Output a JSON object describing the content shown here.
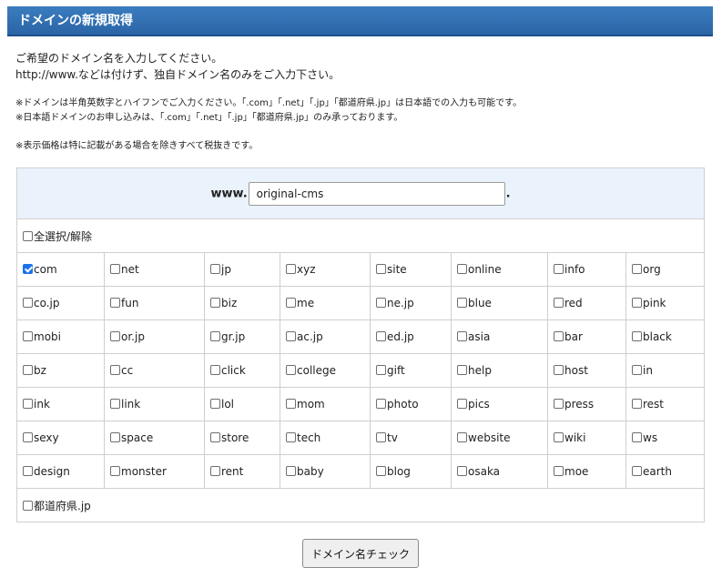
{
  "header": {
    "title": "ドメインの新規取得"
  },
  "intro": {
    "line1": "ご希望のドメイン名を入力してください。",
    "line2": "http://www.などは付けず、独自ドメイン名のみをご入力下さい。"
  },
  "notes": {
    "line1": "※ドメインは半角英数字とハイフンでご入力ください。「.com」「.net」「.jp」「都道府県.jp」は日本語での入力も可能です。",
    "line2": "※日本語ドメインのお申し込みは、「.com」「.net」「.jp」「都道府県.jp」のみ承っております。",
    "line3": "※表示価格は特に記載がある場合を除きすべて税抜きです。"
  },
  "domain_input": {
    "prefix": "www.",
    "value": "original-cms",
    "suffix": "."
  },
  "select_all": {
    "label": "全選択/解除",
    "checked": false
  },
  "tlds": [
    [
      {
        "label": "com",
        "checked": true
      },
      {
        "label": "net",
        "checked": false
      },
      {
        "label": "jp",
        "checked": false
      },
      {
        "label": "xyz",
        "checked": false
      },
      {
        "label": "site",
        "checked": false
      },
      {
        "label": "online",
        "checked": false
      },
      {
        "label": "info",
        "checked": false
      },
      {
        "label": "org",
        "checked": false
      }
    ],
    [
      {
        "label": "co.jp",
        "checked": false
      },
      {
        "label": "fun",
        "checked": false
      },
      {
        "label": "biz",
        "checked": false
      },
      {
        "label": "me",
        "checked": false
      },
      {
        "label": "ne.jp",
        "checked": false
      },
      {
        "label": "blue",
        "checked": false
      },
      {
        "label": "red",
        "checked": false
      },
      {
        "label": "pink",
        "checked": false
      }
    ],
    [
      {
        "label": "mobi",
        "checked": false
      },
      {
        "label": "or.jp",
        "checked": false
      },
      {
        "label": "gr.jp",
        "checked": false
      },
      {
        "label": "ac.jp",
        "checked": false
      },
      {
        "label": "ed.jp",
        "checked": false
      },
      {
        "label": "asia",
        "checked": false
      },
      {
        "label": "bar",
        "checked": false
      },
      {
        "label": "black",
        "checked": false
      }
    ],
    [
      {
        "label": "bz",
        "checked": false
      },
      {
        "label": "cc",
        "checked": false
      },
      {
        "label": "click",
        "checked": false
      },
      {
        "label": "college",
        "checked": false
      },
      {
        "label": "gift",
        "checked": false
      },
      {
        "label": "help",
        "checked": false
      },
      {
        "label": "host",
        "checked": false
      },
      {
        "label": "in",
        "checked": false
      }
    ],
    [
      {
        "label": "ink",
        "checked": false
      },
      {
        "label": "link",
        "checked": false
      },
      {
        "label": "lol",
        "checked": false
      },
      {
        "label": "mom",
        "checked": false
      },
      {
        "label": "photo",
        "checked": false
      },
      {
        "label": "pics",
        "checked": false
      },
      {
        "label": "press",
        "checked": false
      },
      {
        "label": "rest",
        "checked": false
      }
    ],
    [
      {
        "label": "sexy",
        "checked": false
      },
      {
        "label": "space",
        "checked": false
      },
      {
        "label": "store",
        "checked": false
      },
      {
        "label": "tech",
        "checked": false
      },
      {
        "label": "tv",
        "checked": false
      },
      {
        "label": "website",
        "checked": false
      },
      {
        "label": "wiki",
        "checked": false
      },
      {
        "label": "ws",
        "checked": false
      }
    ],
    [
      {
        "label": "design",
        "checked": false
      },
      {
        "label": "monster",
        "checked": false
      },
      {
        "label": "rent",
        "checked": false
      },
      {
        "label": "baby",
        "checked": false
      },
      {
        "label": "blog",
        "checked": false
      },
      {
        "label": "osaka",
        "checked": false
      },
      {
        "label": "moe",
        "checked": false
      },
      {
        "label": "earth",
        "checked": false
      }
    ]
  ],
  "prefecture": {
    "label": "都道府県.jp",
    "checked": false
  },
  "check_button": {
    "label": "ドメイン名チェック"
  }
}
